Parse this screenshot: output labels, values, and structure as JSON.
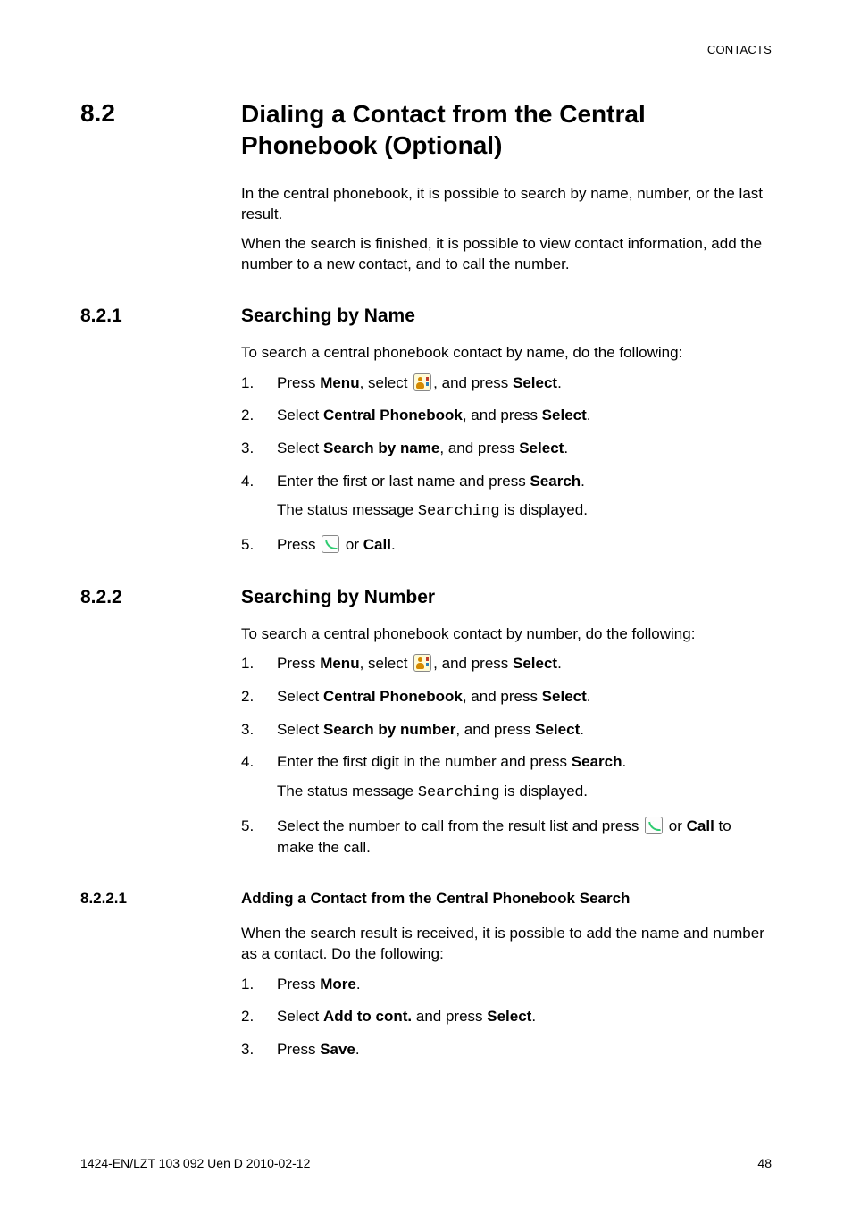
{
  "header": {
    "running": "CONTACTS"
  },
  "sec": {
    "num": "8.2",
    "title": "Dialing a Contact from the Central Phonebook (Optional)",
    "intro1": "In the central phonebook, it is possible to search by name, number, or the last result.",
    "intro2": "When the search is finished, it is possible to view contact information, add the number to a new contact, and to call the number."
  },
  "s821": {
    "num": "8.2.1",
    "title": "Searching by Name",
    "lead": "To search a central phonebook contact by name, do the following:",
    "steps": [
      {
        "n": "1.",
        "pre": "Press ",
        "b1": "Menu",
        "mid1": ", select ",
        "icon": "contacts",
        "mid2": ", and press ",
        "b2": "Select",
        "post": "."
      },
      {
        "n": "2.",
        "pre": "Select ",
        "b1": "Central Phonebook",
        "mid1": ", and press ",
        "b2": "Select",
        "post": "."
      },
      {
        "n": "3.",
        "pre": "Select ",
        "b1": "Search by name",
        "mid1": ", and press ",
        "b2": "Select",
        "post": "."
      },
      {
        "n": "4.",
        "pre": "Enter the first or last name and press ",
        "b1": "Search",
        "post": ".",
        "sub_pre": "The status message ",
        "sub_code": "Searching",
        "sub_post": " is displayed."
      },
      {
        "n": "5.",
        "pre": "Press ",
        "icon": "call",
        "mid2": " or ",
        "b2": "Call",
        "post": "."
      }
    ]
  },
  "s822": {
    "num": "8.2.2",
    "title": "Searching by Number",
    "lead": "To search a central phonebook contact by number, do the following:",
    "steps": [
      {
        "n": "1.",
        "pre": "Press ",
        "b1": "Menu",
        "mid1": ", select ",
        "icon": "contacts",
        "mid2": ", and press ",
        "b2": "Select",
        "post": "."
      },
      {
        "n": "2.",
        "pre": "Select ",
        "b1": "Central Phonebook",
        "mid1": ", and press ",
        "b2": "Select",
        "post": "."
      },
      {
        "n": "3.",
        "pre": "Select ",
        "b1": "Search by number",
        "mid1": ", and press ",
        "b2": "Select",
        "post": "."
      },
      {
        "n": "4.",
        "pre": "Enter the first digit in the number and press ",
        "b1": "Search",
        "post": ".",
        "sub_pre": "The status message ",
        "sub_code": "Searching",
        "sub_post": " is displayed."
      },
      {
        "n": "5.",
        "pre": "Select the number to call from the result list and press ",
        "icon": "call",
        "mid2": " or ",
        "b2": "Call",
        "post": " to make the call."
      }
    ]
  },
  "s8221": {
    "num": "8.2.2.1",
    "title": "Adding a Contact from the Central Phonebook Search",
    "lead": "When the search result is received, it is possible to add the name and number as a contact. Do the following:",
    "steps": [
      {
        "n": "1.",
        "pre": "Press ",
        "b1": "More",
        "post": "."
      },
      {
        "n": "2.",
        "pre": "Select ",
        "b1": "Add to cont.",
        "mid1": " and press ",
        "b2": "Select",
        "post": "."
      },
      {
        "n": "3.",
        "pre": "Press ",
        "b1": "Save",
        "post": "."
      }
    ]
  },
  "footer": {
    "left": "1424-EN/LZT 103 092 Uen D 2010-02-12",
    "right": "48"
  }
}
